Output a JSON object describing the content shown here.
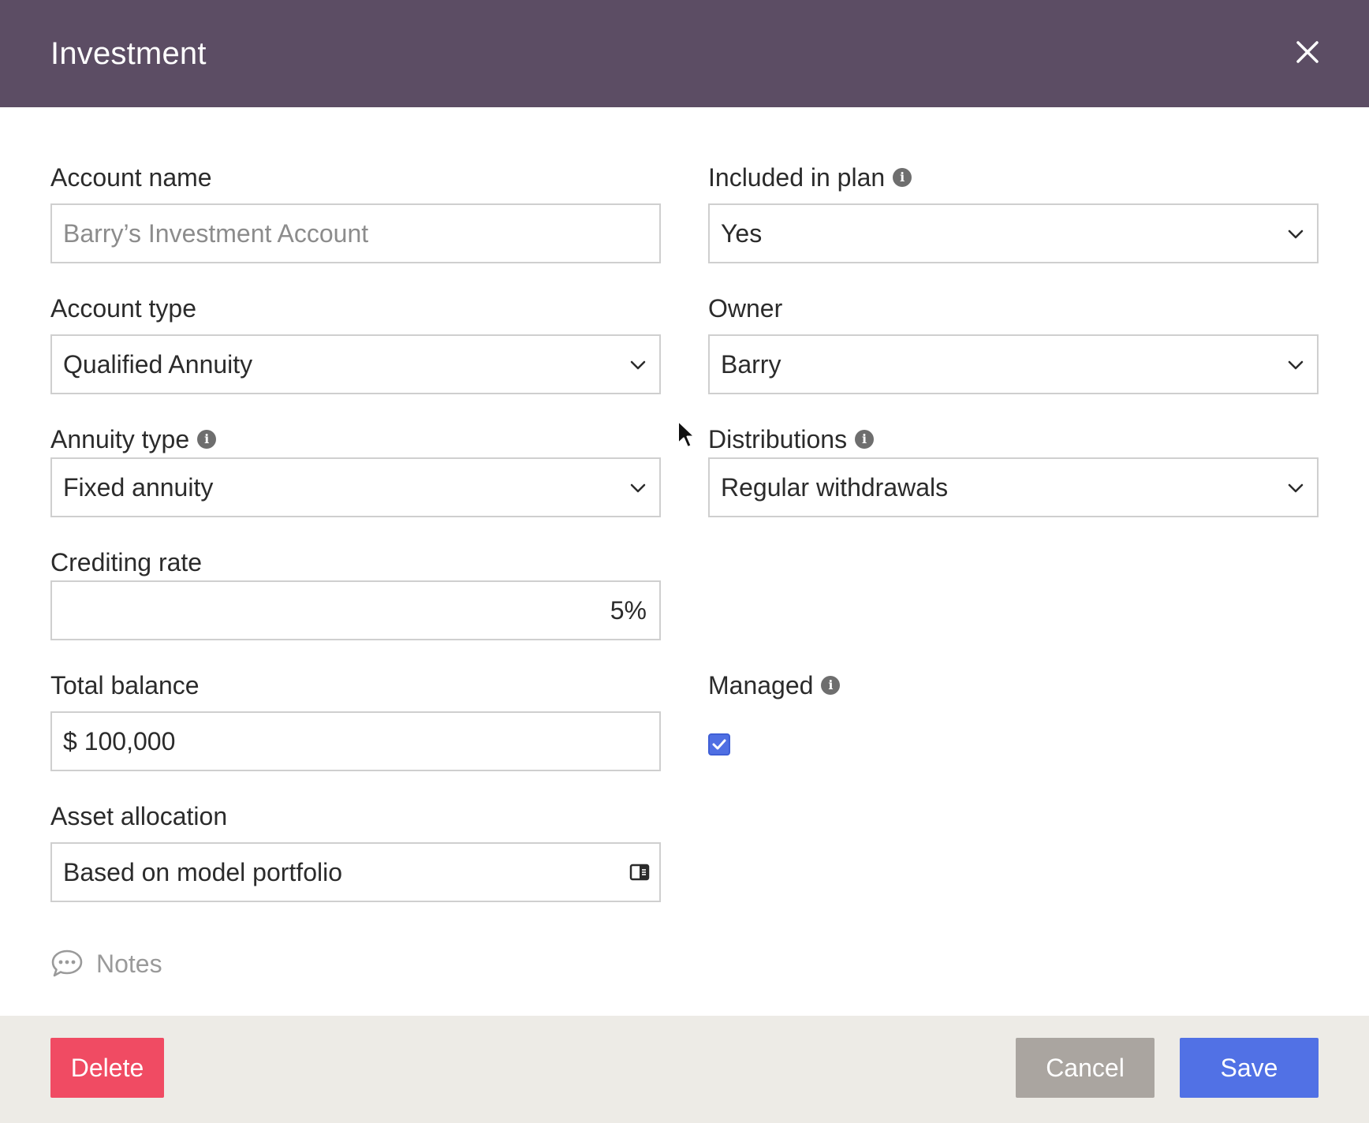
{
  "header": {
    "title": "Investment"
  },
  "form": {
    "account_name": {
      "label": "Account name",
      "placeholder": "Barry’s Investment Account"
    },
    "included_in_plan": {
      "label": "Included in plan",
      "value": "Yes"
    },
    "account_type": {
      "label": "Account type",
      "value": "Qualified Annuity"
    },
    "owner": {
      "label": "Owner",
      "value": "Barry"
    },
    "annuity_type": {
      "label": "Annuity type",
      "value": "Fixed annuity"
    },
    "distributions": {
      "label": "Distributions",
      "value": "Regular withdrawals"
    },
    "crediting_rate": {
      "label": "Crediting rate",
      "value": "5%"
    },
    "total_balance": {
      "label": "Total balance",
      "value": "$ 100,000"
    },
    "managed": {
      "label": "Managed",
      "checked": true
    },
    "asset_allocation": {
      "label": "Asset allocation",
      "value": "Based on model portfolio"
    },
    "notes": {
      "label": "Notes"
    }
  },
  "footer": {
    "delete_label": "Delete",
    "cancel_label": "Cancel",
    "save_label": "Save"
  },
  "icons": {
    "close": "close-icon",
    "info": "info-icon",
    "chevron": "chevron-down-icon",
    "notes": "speech-bubble-icon",
    "allocation": "side-panel-icon",
    "checkbox": "checkmark-icon"
  },
  "colors": {
    "header_bg": "#5c4d64",
    "delete_bg": "#f04b63",
    "cancel_bg": "#aaa5a0",
    "save_bg": "#5171e5",
    "footer_bg": "#edebe6",
    "checkbox": "#4f6fe3"
  }
}
